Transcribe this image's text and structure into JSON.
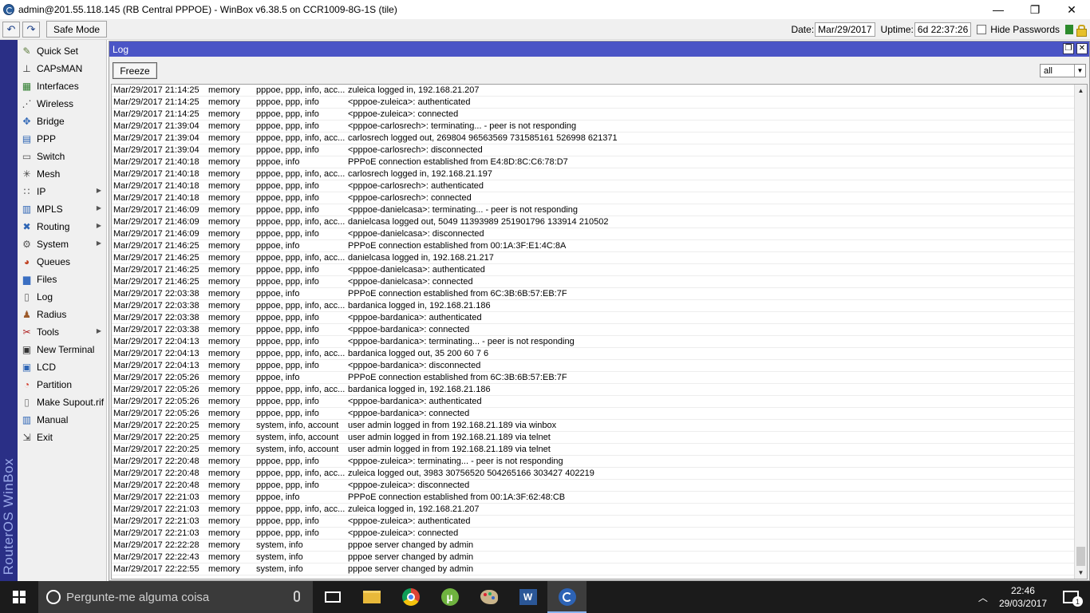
{
  "window": {
    "title": "admin@201.55.118.145 (RB Central PPPOE) - WinBox v6.38.5 on CCR1009-8G-1S (tile)",
    "minimize": "—",
    "maximize": "❐",
    "close": "✕"
  },
  "toolbar": {
    "undo": "↶",
    "redo": "↷",
    "safe_mode": "Safe Mode",
    "date_label": "Date:",
    "date_value": "Mar/29/2017",
    "uptime_label": "Uptime:",
    "uptime_value": "6d 22:37:26",
    "hide_passwords": "Hide Passwords"
  },
  "brand": {
    "side_text": "RouterOS WinBox"
  },
  "sidebar": {
    "items": [
      {
        "label": "Quick Set",
        "icon": "quick-set-icon",
        "glyph": "✎",
        "color": "#5a7a3a",
        "submenu": false
      },
      {
        "label": "CAPsMAN",
        "icon": "capsman-icon",
        "glyph": "⊥",
        "color": "#333333",
        "submenu": false
      },
      {
        "label": "Interfaces",
        "icon": "interfaces-icon",
        "glyph": "▦",
        "color": "#2d7d2d",
        "submenu": false
      },
      {
        "label": "Wireless",
        "icon": "wireless-icon",
        "glyph": "⋰",
        "color": "#444444",
        "submenu": false
      },
      {
        "label": "Bridge",
        "icon": "bridge-icon",
        "glyph": "✥",
        "color": "#2d65b5",
        "submenu": false
      },
      {
        "label": "PPP",
        "icon": "ppp-icon",
        "glyph": "▤",
        "color": "#2d65b5",
        "submenu": false
      },
      {
        "label": "Switch",
        "icon": "switch-icon",
        "glyph": "▭",
        "color": "#555555",
        "submenu": false
      },
      {
        "label": "Mesh",
        "icon": "mesh-icon",
        "glyph": "✳",
        "color": "#444444",
        "submenu": false
      },
      {
        "label": "IP",
        "icon": "ip-icon",
        "glyph": "∷",
        "color": "#444444",
        "submenu": true
      },
      {
        "label": "MPLS",
        "icon": "mpls-icon",
        "glyph": "▥",
        "color": "#2d65b5",
        "submenu": true
      },
      {
        "label": "Routing",
        "icon": "routing-icon",
        "glyph": "✖",
        "color": "#2d65b5",
        "submenu": true
      },
      {
        "label": "System",
        "icon": "system-gear-icon",
        "glyph": "⚙",
        "color": "#555555",
        "submenu": true
      },
      {
        "label": "Queues",
        "icon": "queues-icon",
        "glyph": "◕",
        "color": "#c04020",
        "submenu": false
      },
      {
        "label": "Files",
        "icon": "files-folder-icon",
        "glyph": "▆",
        "color": "#3b6fc2",
        "submenu": false
      },
      {
        "label": "Log",
        "icon": "log-icon",
        "glyph": "▯",
        "color": "#666666",
        "submenu": false
      },
      {
        "label": "Radius",
        "icon": "radius-icon",
        "glyph": "♟",
        "color": "#9c5a2a",
        "submenu": false
      },
      {
        "label": "Tools",
        "icon": "tools-icon",
        "glyph": "✂",
        "color": "#b02020",
        "submenu": true
      },
      {
        "label": "New Terminal",
        "icon": "terminal-icon",
        "glyph": "▣",
        "color": "#333333",
        "submenu": false
      },
      {
        "label": "LCD",
        "icon": "lcd-icon",
        "glyph": "▣",
        "color": "#2d65b5",
        "submenu": false
      },
      {
        "label": "Partition",
        "icon": "partition-icon",
        "glyph": "◔",
        "color": "#d23a2a",
        "submenu": false
      },
      {
        "label": "Make Supout.rif",
        "icon": "supout-file-icon",
        "glyph": "▯",
        "color": "#777777",
        "submenu": false
      },
      {
        "label": "Manual",
        "icon": "manual-book-icon",
        "glyph": "▥",
        "color": "#2d65b5",
        "submenu": false
      },
      {
        "label": "Exit",
        "icon": "exit-icon",
        "glyph": "⇲",
        "color": "#333333",
        "submenu": false
      }
    ]
  },
  "log_window": {
    "title": "Log",
    "freeze": "Freeze",
    "filter_value": "all",
    "rows": [
      {
        "time": "Mar/29/2017 21:14:25",
        "buffer": "memory",
        "topics": "pppoe, ppp, info, acc...",
        "message": "zuleica logged in, 192.168.21.207"
      },
      {
        "time": "Mar/29/2017 21:14:25",
        "buffer": "memory",
        "topics": "pppoe, ppp, info",
        "message": "<pppoe-zuleica>: authenticated"
      },
      {
        "time": "Mar/29/2017 21:14:25",
        "buffer": "memory",
        "topics": "pppoe, ppp, info",
        "message": "<pppoe-zuleica>: connected"
      },
      {
        "time": "Mar/29/2017 21:39:04",
        "buffer": "memory",
        "topics": "pppoe, ppp, info",
        "message": "<pppoe-carlosrech>: terminating... - peer is not responding"
      },
      {
        "time": "Mar/29/2017 21:39:04",
        "buffer": "memory",
        "topics": "pppoe, ppp, info, acc...",
        "message": "carlosrech logged out, 269804 96563569 731585161 526998 621371"
      },
      {
        "time": "Mar/29/2017 21:39:04",
        "buffer": "memory",
        "topics": "pppoe, ppp, info",
        "message": "<pppoe-carlosrech>: disconnected"
      },
      {
        "time": "Mar/29/2017 21:40:18",
        "buffer": "memory",
        "topics": "pppoe, info",
        "message": "PPPoE connection established from E4:8D:8C:C6:78:D7"
      },
      {
        "time": "Mar/29/2017 21:40:18",
        "buffer": "memory",
        "topics": "pppoe, ppp, info, acc...",
        "message": "carlosrech logged in, 192.168.21.197"
      },
      {
        "time": "Mar/29/2017 21:40:18",
        "buffer": "memory",
        "topics": "pppoe, ppp, info",
        "message": "<pppoe-carlosrech>: authenticated"
      },
      {
        "time": "Mar/29/2017 21:40:18",
        "buffer": "memory",
        "topics": "pppoe, ppp, info",
        "message": "<pppoe-carlosrech>: connected"
      },
      {
        "time": "Mar/29/2017 21:46:09",
        "buffer": "memory",
        "topics": "pppoe, ppp, info",
        "message": "<pppoe-danielcasa>: terminating... - peer is not responding"
      },
      {
        "time": "Mar/29/2017 21:46:09",
        "buffer": "memory",
        "topics": "pppoe, ppp, info, acc...",
        "message": "danielcasa logged out, 5049 11393989 251901796 133914 210502"
      },
      {
        "time": "Mar/29/2017 21:46:09",
        "buffer": "memory",
        "topics": "pppoe, ppp, info",
        "message": "<pppoe-danielcasa>: disconnected"
      },
      {
        "time": "Mar/29/2017 21:46:25",
        "buffer": "memory",
        "topics": "pppoe, info",
        "message": "PPPoE connection established from 00:1A:3F:E1:4C:8A"
      },
      {
        "time": "Mar/29/2017 21:46:25",
        "buffer": "memory",
        "topics": "pppoe, ppp, info, acc...",
        "message": "danielcasa logged in, 192.168.21.217"
      },
      {
        "time": "Mar/29/2017 21:46:25",
        "buffer": "memory",
        "topics": "pppoe, ppp, info",
        "message": "<pppoe-danielcasa>: authenticated"
      },
      {
        "time": "Mar/29/2017 21:46:25",
        "buffer": "memory",
        "topics": "pppoe, ppp, info",
        "message": "<pppoe-danielcasa>: connected"
      },
      {
        "time": "Mar/29/2017 22:03:38",
        "buffer": "memory",
        "topics": "pppoe, info",
        "message": "PPPoE connection established from 6C:3B:6B:57:EB:7F"
      },
      {
        "time": "Mar/29/2017 22:03:38",
        "buffer": "memory",
        "topics": "pppoe, ppp, info, acc...",
        "message": "bardanica logged in, 192.168.21.186"
      },
      {
        "time": "Mar/29/2017 22:03:38",
        "buffer": "memory",
        "topics": "pppoe, ppp, info",
        "message": "<pppoe-bardanica>: authenticated"
      },
      {
        "time": "Mar/29/2017 22:03:38",
        "buffer": "memory",
        "topics": "pppoe, ppp, info",
        "message": "<pppoe-bardanica>: connected"
      },
      {
        "time": "Mar/29/2017 22:04:13",
        "buffer": "memory",
        "topics": "pppoe, ppp, info",
        "message": "<pppoe-bardanica>: terminating... - peer is not responding"
      },
      {
        "time": "Mar/29/2017 22:04:13",
        "buffer": "memory",
        "topics": "pppoe, ppp, info, acc...",
        "message": "bardanica logged out, 35 200 60 7 6"
      },
      {
        "time": "Mar/29/2017 22:04:13",
        "buffer": "memory",
        "topics": "pppoe, ppp, info",
        "message": "<pppoe-bardanica>: disconnected"
      },
      {
        "time": "Mar/29/2017 22:05:26",
        "buffer": "memory",
        "topics": "pppoe, info",
        "message": "PPPoE connection established from 6C:3B:6B:57:EB:7F"
      },
      {
        "time": "Mar/29/2017 22:05:26",
        "buffer": "memory",
        "topics": "pppoe, ppp, info, acc...",
        "message": "bardanica logged in, 192.168.21.186"
      },
      {
        "time": "Mar/29/2017 22:05:26",
        "buffer": "memory",
        "topics": "pppoe, ppp, info",
        "message": "<pppoe-bardanica>: authenticated"
      },
      {
        "time": "Mar/29/2017 22:05:26",
        "buffer": "memory",
        "topics": "pppoe, ppp, info",
        "message": "<pppoe-bardanica>: connected"
      },
      {
        "time": "Mar/29/2017 22:20:25",
        "buffer": "memory",
        "topics": "system, info, account",
        "message": "user admin logged in from 192.168.21.189 via winbox"
      },
      {
        "time": "Mar/29/2017 22:20:25",
        "buffer": "memory",
        "topics": "system, info, account",
        "message": "user admin logged in from 192.168.21.189 via telnet"
      },
      {
        "time": "Mar/29/2017 22:20:25",
        "buffer": "memory",
        "topics": "system, info, account",
        "message": "user admin logged in from 192.168.21.189 via telnet"
      },
      {
        "time": "Mar/29/2017 22:20:48",
        "buffer": "memory",
        "topics": "pppoe, ppp, info",
        "message": "<pppoe-zuleica>: terminating... - peer is not responding"
      },
      {
        "time": "Mar/29/2017 22:20:48",
        "buffer": "memory",
        "topics": "pppoe, ppp, info, acc...",
        "message": "zuleica logged out, 3983 30756520 504265166 303427 402219"
      },
      {
        "time": "Mar/29/2017 22:20:48",
        "buffer": "memory",
        "topics": "pppoe, ppp, info",
        "message": "<pppoe-zuleica>: disconnected"
      },
      {
        "time": "Mar/29/2017 22:21:03",
        "buffer": "memory",
        "topics": "pppoe, info",
        "message": "PPPoE connection established from 00:1A:3F:62:48:CB"
      },
      {
        "time": "Mar/29/2017 22:21:03",
        "buffer": "memory",
        "topics": "pppoe, ppp, info, acc...",
        "message": "zuleica logged in, 192.168.21.207"
      },
      {
        "time": "Mar/29/2017 22:21:03",
        "buffer": "memory",
        "topics": "pppoe, ppp, info",
        "message": "<pppoe-zuleica>: authenticated"
      },
      {
        "time": "Mar/29/2017 22:21:03",
        "buffer": "memory",
        "topics": "pppoe, ppp, info",
        "message": "<pppoe-zuleica>: connected"
      },
      {
        "time": "Mar/29/2017 22:22:28",
        "buffer": "memory",
        "topics": "system, info",
        "message": "pppoe server changed by admin"
      },
      {
        "time": "Mar/29/2017 22:22:43",
        "buffer": "memory",
        "topics": "system, info",
        "message": "pppoe server changed by admin"
      },
      {
        "time": "Mar/29/2017 22:22:55",
        "buffer": "memory",
        "topics": "system, info",
        "message": "pppoe server changed by admin"
      }
    ]
  },
  "taskbar": {
    "search_placeholder": "Pergunte-me alguma coisa",
    "apps": [
      {
        "name": "task-view-icon",
        "active": false
      },
      {
        "name": "file-explorer-icon",
        "active": false
      },
      {
        "name": "chrome-icon",
        "active": false
      },
      {
        "name": "utorrent-icon",
        "active": false
      },
      {
        "name": "paint-palette-icon",
        "active": false
      },
      {
        "name": "word-icon",
        "active": false
      },
      {
        "name": "winbox-icon",
        "active": true
      }
    ],
    "clock_time": "22:46",
    "clock_date": "29/03/2017",
    "notification_count": "1"
  }
}
